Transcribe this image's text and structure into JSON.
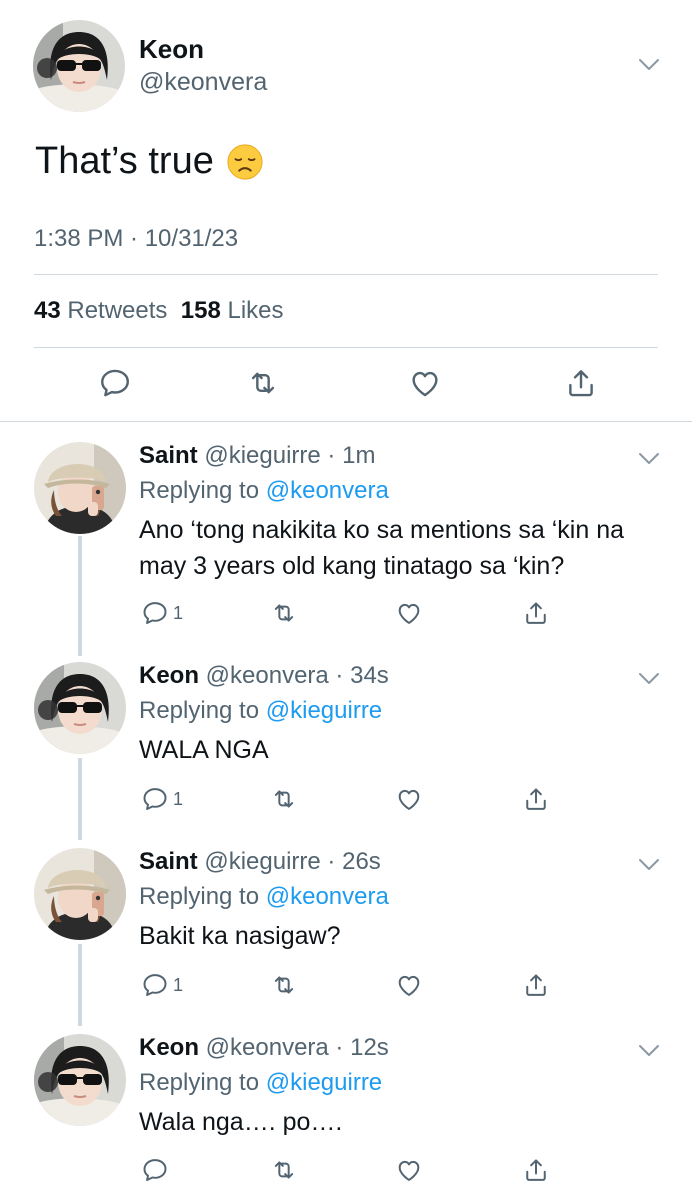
{
  "main_tweet": {
    "name": "Keon",
    "handle": "@keonvera",
    "text": "That’s true",
    "emoji_icon": "disappointed-face-emoji",
    "time": "1:38 PM · 10/31/23",
    "retweets_count": "43",
    "retweets_label": "Retweets",
    "likes_count": "158",
    "likes_label": "Likes"
  },
  "replies": [
    {
      "name": "Saint",
      "handle_time": "@kieguirre · 1m",
      "replying_prefix": "Replying to",
      "replying_to": "@keonvera",
      "text": "Ano ‘tong nakikita ko sa mentions sa ‘kin na may 3 years old kang tinatago sa ‘kin?",
      "reply_count": "1"
    },
    {
      "name": "Keon",
      "handle_time": "@keonvera · 34s",
      "replying_prefix": "Replying to",
      "replying_to": "@kieguirre",
      "text": "WALA NGA",
      "reply_count": "1"
    },
    {
      "name": "Saint",
      "handle_time": "@kieguirre · 26s",
      "replying_prefix": "Replying to",
      "replying_to": "@keonvera",
      "text": "Bakit ka nasigaw?",
      "reply_count": "1"
    },
    {
      "name": "Keon",
      "handle_time": "@keonvera · 12s",
      "replying_prefix": "Replying to",
      "replying_to": "@kieguirre",
      "text": "Wala nga…. po….",
      "reply_count": ""
    }
  ],
  "colors": {
    "link": "#1d9bf0",
    "secondary_text": "#536471",
    "divider": "#cfd9de"
  }
}
